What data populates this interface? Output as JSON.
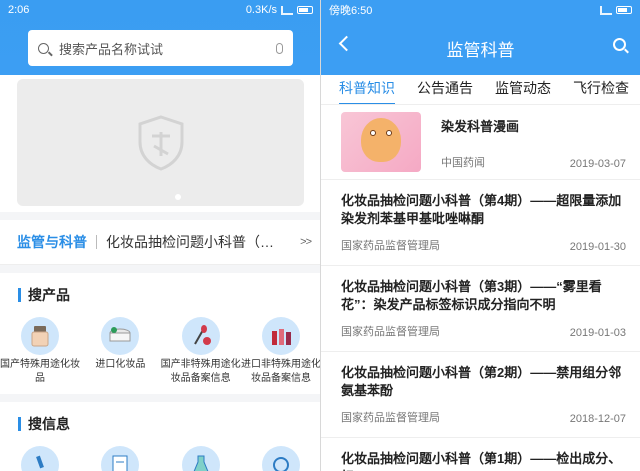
{
  "left": {
    "status": {
      "time": "2:06",
      "net": "0.3K/s",
      "battery": ""
    },
    "search": {
      "placeholder": "搜索产品名称试试"
    },
    "news_strip": {
      "tag": "监管与科普",
      "ticker": "化妆品抽检问题小科普（…",
      "more": ">>"
    },
    "sections": [
      {
        "title": "搜产品",
        "items": [
          {
            "label": "国产特殊用途化妆品",
            "icon": "foundation-bottle-icon"
          },
          {
            "label": "进口化妆品",
            "icon": "cream-jar-icon"
          },
          {
            "label": "国产非特殊用途化妆品备案信息",
            "icon": "brush-icon"
          },
          {
            "label": "进口非特殊用途化妆品备案信息",
            "icon": "lipstick-icon"
          }
        ]
      },
      {
        "title": "搜信息",
        "items": [
          {
            "label": "",
            "icon": "microscope-icon"
          },
          {
            "label": "",
            "icon": "document-icon"
          },
          {
            "label": "",
            "icon": "flask-icon"
          },
          {
            "label": "",
            "icon": "info-icon"
          }
        ]
      }
    ]
  },
  "right": {
    "status": {
      "time": "傍晚6:50"
    },
    "title": "监管科普",
    "tabs": [
      "科普知识",
      "公告通告",
      "监管动态",
      "飞行检查",
      "通"
    ],
    "articles": [
      {
        "title": "染发科普漫画",
        "source": "中国药闻",
        "date": "2019-03-07",
        "has_thumb": true
      },
      {
        "title": "化妆品抽检问题小科普（第4期）——超限量添加染发剂苯基甲基吡唑啉酮",
        "source": "国家药品监督管理局",
        "date": "2019-01-30"
      },
      {
        "title": "化妆品抽检问题小科普（第3期）——“雾里看花”：染发产品标签标识成分指向不明",
        "source": "国家药品监督管理局",
        "date": "2019-01-03"
      },
      {
        "title": "化妆品抽检问题小科普（第2期）——禁用组分邻氨基苯酚",
        "source": "国家药品监督管理局",
        "date": "2018-12-07"
      },
      {
        "title": "化妆品抽检问题小科普（第1期）——检出成分、标",
        "source": "",
        "date": ""
      }
    ]
  },
  "colors": {
    "brand_blue": "#3c9ef3",
    "accent": "#2a8ee6"
  }
}
